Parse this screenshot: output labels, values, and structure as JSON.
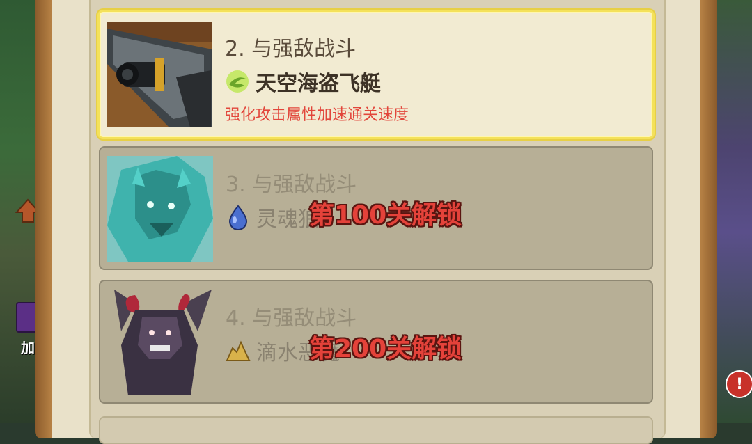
{
  "stages": [
    {
      "title": "2. 与强敌战斗",
      "enemy_name": "天空海盗飞艇",
      "description": "强化攻击属性加速通关速度",
      "element_icon": "wind-icon",
      "element_color": "#8fd13f",
      "portrait": "airship-cannon-portrait",
      "state": "active"
    },
    {
      "title": "3. 与强敌战斗",
      "enemy_name": "灵魂狼",
      "unlock_text": "第100关解锁",
      "element_icon": "water-drop-icon",
      "element_color": "#4a6fd0",
      "portrait": "spirit-wolf-portrait",
      "state": "locked"
    },
    {
      "title": "4. 与强敌战斗",
      "enemy_name": "滴水恶魔",
      "unlock_text": "第200关解锁",
      "element_icon": "earth-icon",
      "element_color": "#d9b24a",
      "portrait": "horned-demon-portrait",
      "state": "locked"
    }
  ],
  "side": {
    "left_label": "加"
  },
  "colors": {
    "highlight_border": "#f4e15a",
    "unlock_text": "#e4423a",
    "description": "#e2463b"
  }
}
